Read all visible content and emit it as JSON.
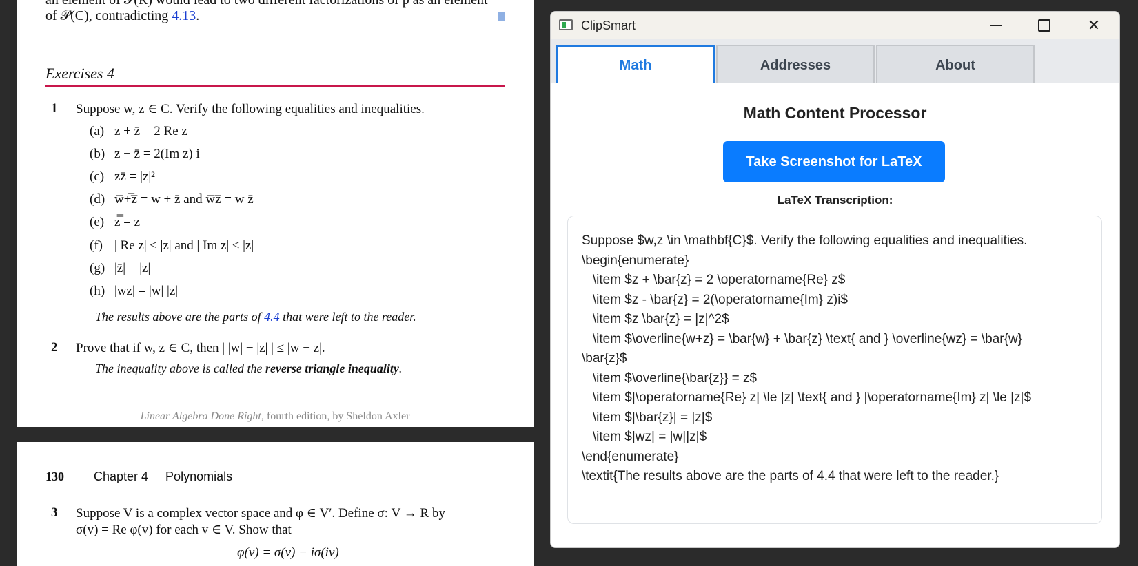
{
  "pdf": {
    "cut_line": "an element of 𝒫(R) would lead to two different factorizations of p as an element",
    "contradiction_prefix": "of 𝒫(C), contradicting ",
    "contradiction_ref": "4.13",
    "contradiction_suffix": ".",
    "exercises_heading": "Exercises 4",
    "q1_number": "1",
    "q1_text": "Suppose w, z ∈ C. Verify the following equalities and inequalities.",
    "q1_items": [
      {
        "label": "(a)",
        "text": "z + z̄ = 2 Re z"
      },
      {
        "label": "(b)",
        "text": "z − z̄ = 2(Im z) i"
      },
      {
        "label": "(c)",
        "text": "zz̄ = |z|²"
      },
      {
        "label": "(d)",
        "text": "w̅+̅z̅ = w̄ + z̄ and w̅z̅ = w̄ z̄"
      },
      {
        "label": "(e)",
        "text": "z̿ = z"
      },
      {
        "label": "(f)",
        "text": "| Re z| ≤ |z| and | Im z| ≤ |z|"
      },
      {
        "label": "(g)",
        "text": "|z̄| = |z|"
      },
      {
        "label": "(h)",
        "text": "|wz| = |w| |z|"
      }
    ],
    "q1_note_prefix": "The results above are the parts of ",
    "q1_note_ref": "4.4",
    "q1_note_suffix": " that were left to the reader.",
    "q2_number": "2",
    "q2_text": "Prove that if w, z ∈ C, then | |w| − |z| | ≤ |w − z|.",
    "q2_note_prefix": "The inequality above is called the ",
    "q2_note_bold": "reverse triangle inequality",
    "q2_note_suffix": ".",
    "footer_title": "Linear Algebra Done Right",
    "footer_rest": ", fourth edition, by Sheldon Axler",
    "page2_number": "130",
    "page2_chapter": "Chapter 4     Polynomials",
    "q3_number": "3",
    "q3_line1": "Suppose V is a complex vector space and φ ∈ V′. Define σ: V → R by",
    "q3_line2": "σ(v) = Re φ(v) for each v ∈ V. Show that",
    "q3_line3": "φ(v) = σ(v) − iσ(iv)"
  },
  "window": {
    "title": "ClipSmart",
    "minimize_glyph": "—",
    "close_glyph": "✕",
    "tabs": [
      {
        "label": "Math",
        "active": true
      },
      {
        "label": "Addresses",
        "active": false
      },
      {
        "label": "About",
        "active": false
      }
    ],
    "heading": "Math Content Processor",
    "screenshot_button": "Take Screenshot for LaTeX",
    "transcription_label": "LaTeX Transcription:",
    "latex_output": "Suppose $w,z \\in \\mathbf{C}$. Verify the following equalities and inequalities.\n\\begin{enumerate}\n   \\item $z + \\bar{z} = 2 \\operatorname{Re} z$\n   \\item $z - \\bar{z} = 2(\\operatorname{Im} z)i$\n   \\item $z \\bar{z} = |z|^2$\n   \\item $\\overline{w+z} = \\bar{w} + \\bar{z} \\text{ and } \\overline{wz} = \\bar{w}\n\\bar{z}$\n   \\item $\\overline{\\bar{z}} = z$\n   \\item $|\\operatorname{Re} z| \\le |z| \\text{ and } |\\operatorname{Im} z| \\le |z|$\n   \\item $|\\bar{z}| = |z|$\n   \\item $|wz| = |w||z|$\n\\end{enumerate}\n\\textit{The results above are the parts of 4.4 that were left to the reader.}",
    "colors": {
      "accent": "#0a7cff",
      "active_tab_text": "#1f7ae0",
      "titlebar_bg": "#f3f1ec",
      "tabstrip_bg": "#e8eaed"
    }
  }
}
